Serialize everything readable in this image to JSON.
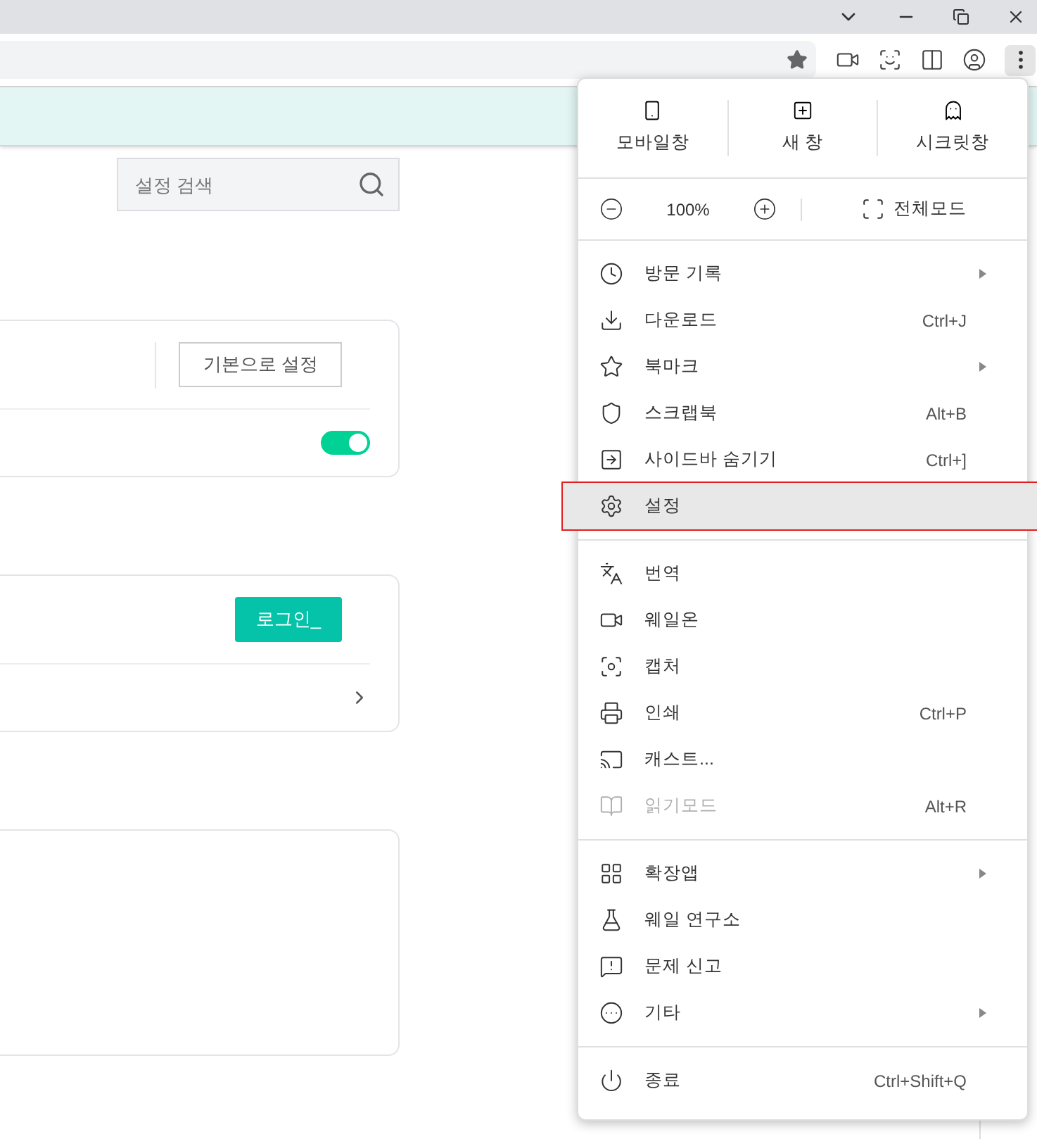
{
  "search": {
    "placeholder": "설정 검색"
  },
  "cards": [
    {
      "button": {
        "label": "기본으로 설정",
        "kind": "outline"
      },
      "toggle": {
        "on": true
      }
    },
    {
      "button": {
        "label": "로그인_",
        "kind": "primary"
      },
      "chevron": true
    }
  ],
  "menu": {
    "window_buttons": [
      {
        "label": "모바일창"
      },
      {
        "label": "새 창"
      },
      {
        "label": "시크릿창"
      }
    ],
    "zoom": {
      "reading": "100%"
    },
    "fullscreen": {
      "label": "전체모드"
    },
    "sections": [
      [
        {
          "label": "방문 기록",
          "submenu": true,
          "disabled": false,
          "selected": false
        },
        {
          "label": "다운로드",
          "shortcut": "Ctrl+J",
          "submenu": false,
          "disabled": false,
          "selected": false
        },
        {
          "label": "북마크",
          "submenu": true,
          "disabled": false,
          "selected": false
        },
        {
          "label": "스크랩북",
          "shortcut": "Alt+B",
          "submenu": false,
          "disabled": false,
          "selected": false
        },
        {
          "label": "사이드바 숨기기",
          "shortcut": "Ctrl+]",
          "submenu": false,
          "disabled": false,
          "selected": false
        },
        {
          "label": "설정",
          "submenu": false,
          "disabled": false,
          "selected": true
        }
      ],
      [
        {
          "label": "번역",
          "submenu": false,
          "disabled": false,
          "selected": false
        },
        {
          "label": "웨일온",
          "submenu": false,
          "disabled": false,
          "selected": false
        },
        {
          "label": "캡처",
          "submenu": false,
          "disabled": false,
          "selected": false
        },
        {
          "label": "인쇄",
          "shortcut": "Ctrl+P",
          "submenu": false,
          "disabled": false,
          "selected": false
        },
        {
          "label": "캐스트...",
          "submenu": false,
          "disabled": false,
          "selected": false
        },
        {
          "label": "읽기모드",
          "shortcut": "Alt+R",
          "submenu": false,
          "disabled": true,
          "selected": false
        }
      ],
      [
        {
          "label": "확장앱",
          "submenu": true,
          "disabled": false,
          "selected": false
        },
        {
          "label": "웨일 연구소",
          "submenu": false,
          "disabled": false,
          "selected": false
        },
        {
          "label": "문제 신고",
          "submenu": false,
          "disabled": false,
          "selected": false
        },
        {
          "label": "기타",
          "submenu": true,
          "disabled": false,
          "selected": false
        }
      ],
      [
        {
          "label": "종료",
          "shortcut": "Ctrl+Shift+Q",
          "submenu": false,
          "disabled": false,
          "selected": false
        }
      ]
    ]
  }
}
